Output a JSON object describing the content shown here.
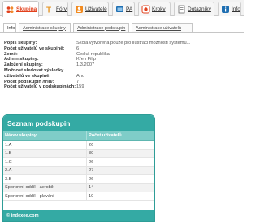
{
  "tabs": [
    {
      "label": "Skupina",
      "icon": "group-icon",
      "color": "#e2401c"
    },
    {
      "label": "Fóry",
      "icon": "forum-icon",
      "color": "#e69a2e"
    },
    {
      "label": "Uživatelé",
      "icon": "users-icon",
      "color": "#e2401c"
    },
    {
      "label": "PA",
      "icon": "pa-icon",
      "color": "#1f6fb2"
    },
    {
      "label": "Kroky",
      "icon": "steps-icon",
      "color": "#e2401c"
    },
    {
      "label": "Dotazníky",
      "icon": "questionnaire-icon",
      "color": "#555555"
    },
    {
      "label": "Info",
      "icon": "info-icon",
      "color": "#1f6fb2"
    }
  ],
  "subtabs": [
    "Info",
    "Administrace skupiny",
    "Administrace podskupin",
    "Administrace uživatelů"
  ],
  "info": [
    {
      "label": "Popis skupiny:",
      "value": "Škola vytvořená pouze pro ilustraci možností systému..."
    },
    {
      "label": "Počet uživatelů ve skupině:",
      "value": "6"
    },
    {
      "label": "Země:",
      "value": "Česká republika"
    },
    {
      "label": "Admin skupiny:",
      "value": "Křen Filip"
    },
    {
      "label": "Založení skupiny:",
      "value": "1.3.2007"
    },
    {
      "label": "Možnost sledovat výsledky",
      "value": ""
    },
    {
      "label": "uživatelů ve skupině:",
      "value": "Ano"
    },
    {
      "label": "Počet podskupin /tříd/:",
      "value": "7"
    },
    {
      "label": "Počet uživatelů v podskupinách:",
      "value": "159"
    }
  ],
  "panel": {
    "title": "Seznam podskupin",
    "col1": "Název skupiny",
    "col2": "Počet uživatelů",
    "rows": [
      {
        "name": "1.A",
        "count": "26"
      },
      {
        "name": "1.B",
        "count": "30"
      },
      {
        "name": "1.C",
        "count": "26"
      },
      {
        "name": "2.A",
        "count": "27"
      },
      {
        "name": "3.B",
        "count": "26"
      },
      {
        "name": "Sportovní oddíl - aerobik",
        "count": "14"
      },
      {
        "name": "Sportovní oddíl - plavání",
        "count": "10"
      }
    ],
    "footer": "© indexee.com"
  },
  "colors": {
    "accent": "#34aaa4",
    "header_light": "#7fcdc8",
    "active_tab": "#e2401c"
  }
}
